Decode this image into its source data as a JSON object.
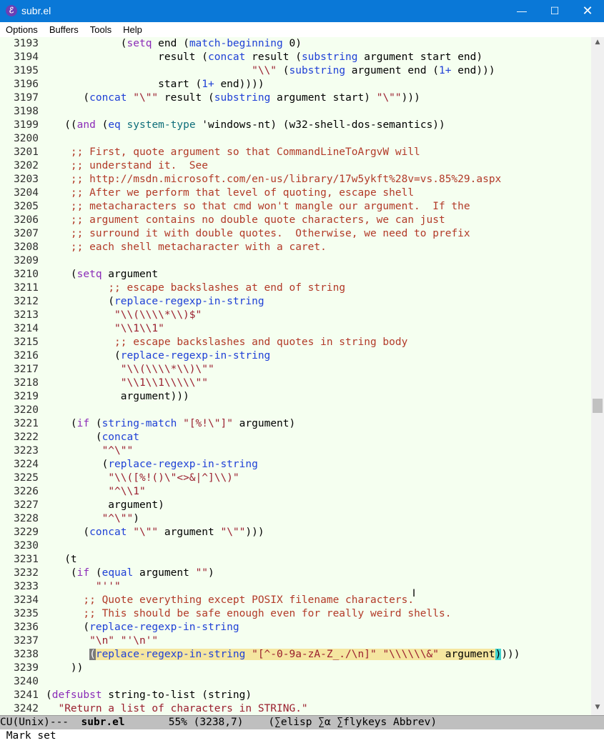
{
  "window": {
    "title": "subr.el",
    "app_icon": "emacs-icon"
  },
  "menu": [
    "Options",
    "Buffers",
    "Tools",
    "Help"
  ],
  "lines": [
    {
      "n": "3193",
      "t": "            (setq end (match-beginning 0)"
    },
    {
      "n": "3194",
      "t": "                  result (concat result (substring argument start end)"
    },
    {
      "n": "3195",
      "t": "                                 \"\\\\\" (substring argument end (1+ end)))"
    },
    {
      "n": "3196",
      "t": "                  start (1+ end))))"
    },
    {
      "n": "3197",
      "t": "      (concat \"\\\"\" result (substring argument start) \"\\\"\")))"
    },
    {
      "n": "3198",
      "t": ""
    },
    {
      "n": "3199",
      "t": "   ((and (eq system-type 'windows-nt) (w32-shell-dos-semantics))"
    },
    {
      "n": "3200",
      "t": ""
    },
    {
      "n": "3201",
      "t": "    ;; First, quote argument so that CommandLineToArgvW will"
    },
    {
      "n": "3202",
      "t": "    ;; understand it.  See"
    },
    {
      "n": "3203",
      "t": "    ;; http://msdn.microsoft.com/en-us/library/17w5ykft%28v=vs.85%29.aspx"
    },
    {
      "n": "3204",
      "t": "    ;; After we perform that level of quoting, escape shell"
    },
    {
      "n": "3205",
      "t": "    ;; metacharacters so that cmd won't mangle our argument.  If the"
    },
    {
      "n": "3206",
      "t": "    ;; argument contains no double quote characters, we can just"
    },
    {
      "n": "3207",
      "t": "    ;; surround it with double quotes.  Otherwise, we need to prefix"
    },
    {
      "n": "3208",
      "t": "    ;; each shell metacharacter with a caret."
    },
    {
      "n": "3209",
      "t": ""
    },
    {
      "n": "3210",
      "t": "    (setq argument"
    },
    {
      "n": "3211",
      "t": "          ;; escape backslashes at end of string"
    },
    {
      "n": "3212",
      "t": "          (replace-regexp-in-string"
    },
    {
      "n": "3213",
      "t": "           \"\\\\(\\\\\\\\*\\\\)$\""
    },
    {
      "n": "3214",
      "t": "           \"\\\\1\\\\1\""
    },
    {
      "n": "3215",
      "t": "           ;; escape backslashes and quotes in string body"
    },
    {
      "n": "3216",
      "t": "           (replace-regexp-in-string"
    },
    {
      "n": "3217",
      "t": "            \"\\\\(\\\\\\\\*\\\\)\\\"\""
    },
    {
      "n": "3218",
      "t": "            \"\\\\1\\\\1\\\\\\\\\\\"\""
    },
    {
      "n": "3219",
      "t": "            argument)))"
    },
    {
      "n": "3220",
      "t": ""
    },
    {
      "n": "3221",
      "t": "    (if (string-match \"[%!\\\"]\" argument)"
    },
    {
      "n": "3222",
      "t": "        (concat"
    },
    {
      "n": "3223",
      "t": "         \"^\\\"\""
    },
    {
      "n": "3224",
      "t": "         (replace-regexp-in-string"
    },
    {
      "n": "3225",
      "t": "          \"\\\\([%!()\\\"<>&|^]\\\\)\""
    },
    {
      "n": "3226",
      "t": "          \"^\\\\1\""
    },
    {
      "n": "3227",
      "t": "          argument)"
    },
    {
      "n": "3228",
      "t": "         \"^\\\"\")"
    },
    {
      "n": "3229",
      "t": "      (concat \"\\\"\" argument \"\\\"\")))"
    },
    {
      "n": "3230",
      "t": ""
    },
    {
      "n": "3231",
      "t": "   (t"
    },
    {
      "n": "3232",
      "t": "    (if (equal argument \"\")"
    },
    {
      "n": "3233",
      "t": "        \"''\""
    },
    {
      "n": "3234",
      "t": "      ;; Quote everything except POSIX filename characters."
    },
    {
      "n": "3235",
      "t": "      ;; This should be safe enough even for really weird shells."
    },
    {
      "n": "3236",
      "t": "      (replace-regexp-in-string"
    },
    {
      "n": "3237",
      "t": "       \"\\n\" \"'\\n'\""
    },
    {
      "n": "3238",
      "t": "       (replace-regexp-in-string \"[^-0-9a-zA-Z_./\\n]\" \"\\\\\\\\\\\\&\" argument))))"
    },
    {
      "n": "3239",
      "t": "    ))"
    },
    {
      "n": "3240",
      "t": ""
    },
    {
      "n": "3241",
      "t": "(defsubst string-to-list (string)"
    },
    {
      "n": "3242",
      "t": "  \"Return a list of characters in STRING.\""
    }
  ],
  "modeline": {
    "prefix": "CU(Unix)---  ",
    "buffer": "subr.el",
    "position": "       55% (3238,7)    (∑elisp ∑α ∑flykeys Abbrev)"
  },
  "minibuffer": {
    "text": " Mark set"
  },
  "colors": {
    "titlebar": "#0a78d7",
    "background": "#f5fff0",
    "region": "#f5e6a0",
    "cursor": "#3dd3cf",
    "modeline": "#bfbfbf"
  },
  "icons": {
    "minimize": "minimize-icon",
    "maximize": "maximize-icon",
    "close": "close-icon"
  }
}
